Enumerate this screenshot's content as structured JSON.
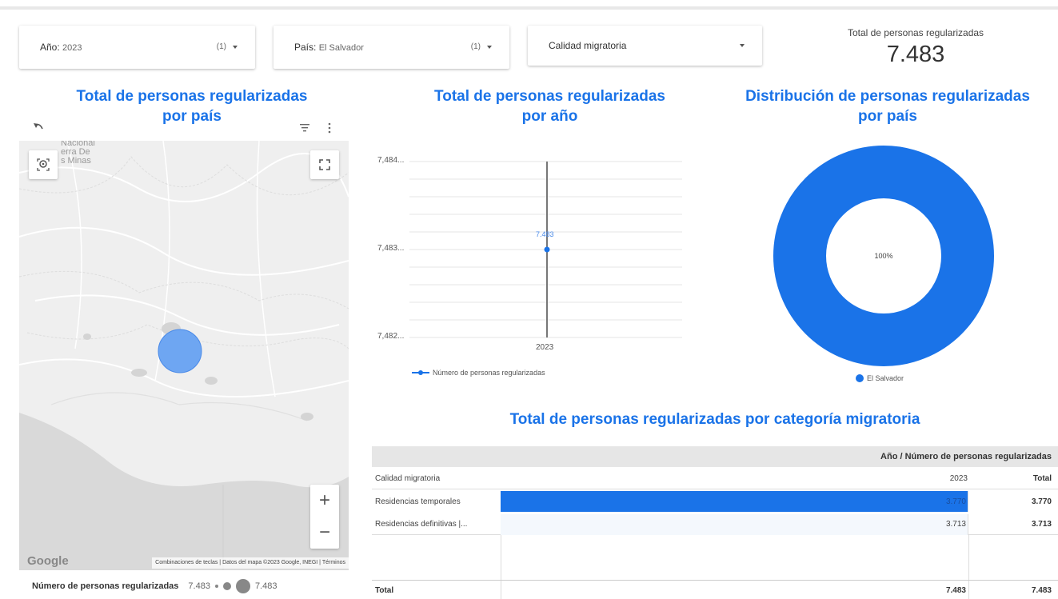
{
  "filters": {
    "year": {
      "label": "Año",
      "value": "2023",
      "count": "(1)"
    },
    "country": {
      "label": "País",
      "value": "El Salvador",
      "count": "(1)"
    },
    "migratory": {
      "label": "Calidad migratoria"
    }
  },
  "kpi": {
    "label": "Total de personas regularizadas",
    "value": "7.483"
  },
  "map_section": {
    "title_line1": "Total de personas regularizadas",
    "title_line2": "por país",
    "place_labels": [
      "Nacional",
      "erra De",
      "s Minas"
    ],
    "attribution": "Combinaciones de teclas  |  Datos del mapa ©2023 Google, INEGI  |  Términos",
    "google_logo": "Google",
    "zoom_in": "+",
    "zoom_out": "−",
    "legend": {
      "title": "Número de personas regularizadas",
      "min": "7.483",
      "max": "7.483"
    },
    "icons": [
      "undo-icon",
      "filter-icon",
      "more-vert-icon",
      "location-icon",
      "fullscreen-icon"
    ]
  },
  "year_section": {
    "title_line1": "Total de personas regularizadas",
    "title_line2": "por año"
  },
  "donut_section": {
    "title_line1": "Distribución de personas regularizadas",
    "title_line2": "por país"
  },
  "table_section": {
    "title": "Total de personas regularizadas por categoría migratoria",
    "header_group": "Año / Número de personas regularizadas",
    "col_dim": "Calidad migratoria",
    "col_year": "2023",
    "col_total": "Total",
    "rows": [
      {
        "label": "Residencias temporales",
        "year": "3.770",
        "total": "3.770",
        "share": 1.0
      },
      {
        "label": "Residencias definitivas |...",
        "year": "3.713",
        "total": "3.713",
        "share": 0.985
      }
    ],
    "footer": {
      "label": "Total",
      "year": "7.483",
      "total": "7.483"
    }
  },
  "colors": {
    "accent": "#1a73e8",
    "bar": "#1a73e8",
    "bubble": "#6ea6f2",
    "donut": "#1a73e8"
  },
  "chart_data": [
    {
      "type": "line",
      "x": [
        "2023"
      ],
      "series": [
        {
          "name": "Número de personas regularizadas",
          "values": [
            7483
          ]
        }
      ],
      "data_labels": [
        "7.483"
      ],
      "yticks": [
        "7,484...",
        "7,483...",
        "7,482..."
      ],
      "ylim": [
        7482,
        7484
      ],
      "legend": "bottom-left",
      "grid": true
    },
    {
      "type": "pie",
      "donut": true,
      "categories": [
        "El Salvador"
      ],
      "values": [
        100
      ],
      "data_labels": [
        "100%"
      ],
      "legend": "bottom"
    }
  ]
}
